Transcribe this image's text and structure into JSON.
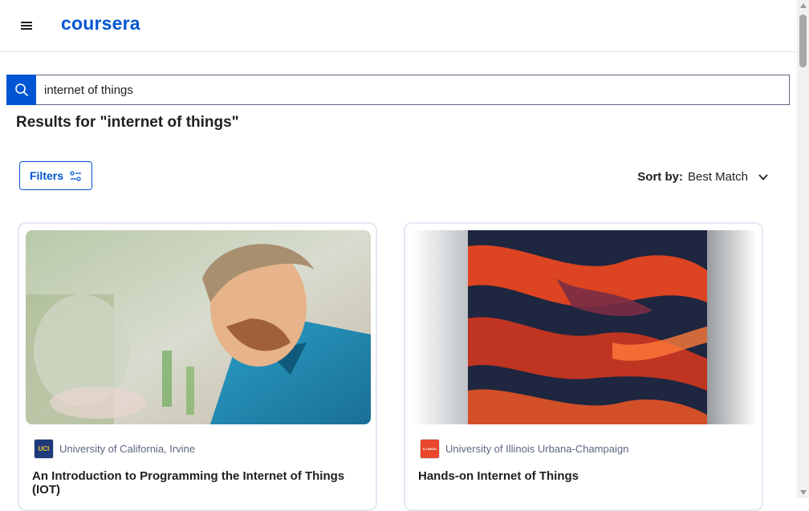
{
  "header": {
    "logo": "coursera",
    "menu_icon": "hamburger-menu-icon"
  },
  "search": {
    "value": "internet of things",
    "icon": "search-icon"
  },
  "results": {
    "title": "Results for \"internet of things\""
  },
  "filters": {
    "label": "Filters",
    "icon": "filter-sliders-icon"
  },
  "sort": {
    "label": "Sort by:",
    "value": "Best Match",
    "icon": "chevron-down-icon"
  },
  "cards": [
    {
      "partner_logo_text": "UCI",
      "partner": "University of California, Irvine",
      "title": "An Introduction to Programming the Internet of Things (IOT)"
    },
    {
      "partner_logo_text": "ILLINOIS",
      "partner": "University of Illinois Urbana-Champaign",
      "title": "Hands-on Internet of Things"
    }
  ],
  "colors": {
    "brand": "#0056d2",
    "text": "#1f1f1f",
    "muted": "#5b6780",
    "uci_navy": "#1f3a7a",
    "uci_gold": "#f2c230",
    "illinois_orange": "#e8472c"
  }
}
